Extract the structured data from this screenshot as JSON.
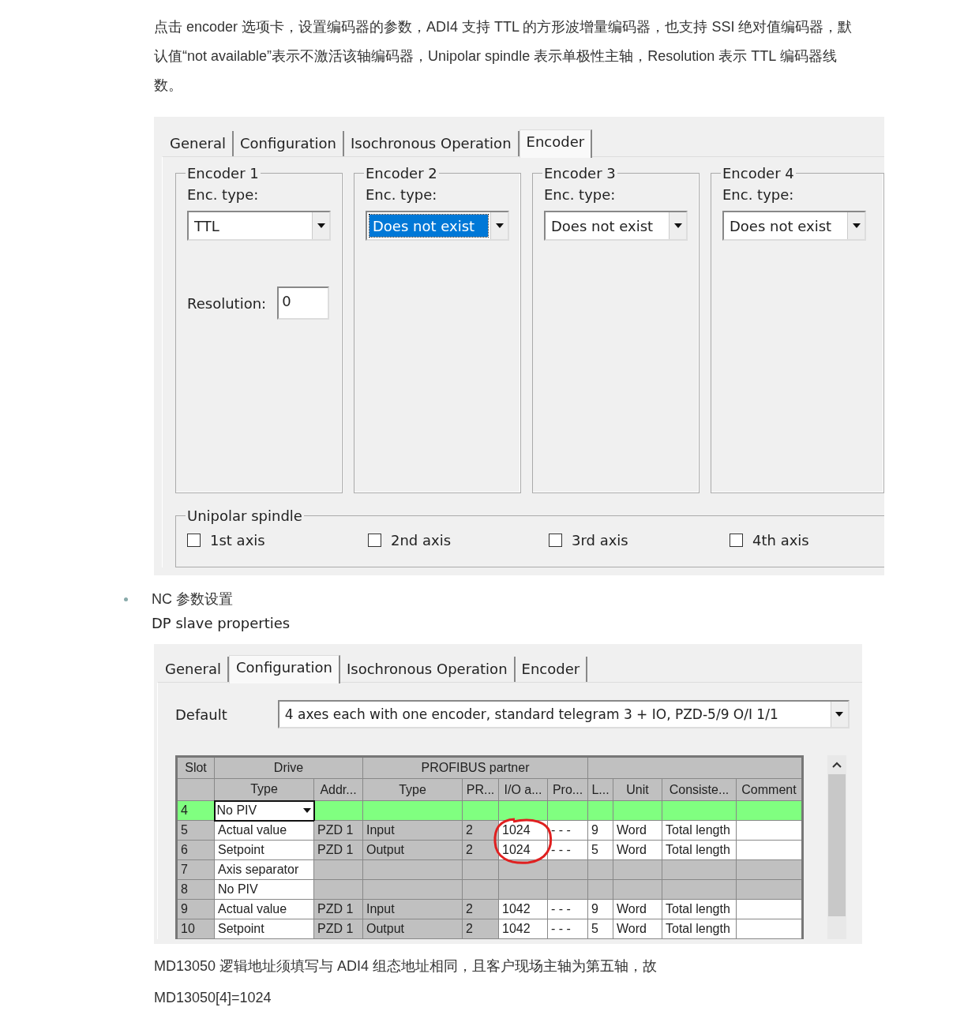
{
  "intro": "点击 encoder 选项卡，设置编码器的参数，ADI4 支持 TTL 的方形波增量编码器，也支持 SSI 绝对值编码器，默认值“not available”表示不激活该轴编码器，Unipolar spindle 表示单极性主轴，Resolution 表示 TTL 编码器线数。",
  "encoder_dialog": {
    "tabs": [
      {
        "label": "General",
        "selected": false
      },
      {
        "label": "Configuration",
        "selected": false
      },
      {
        "label": "Isochronous Operation",
        "selected": false
      },
      {
        "label": "Encoder",
        "selected": true
      }
    ],
    "encoders": [
      {
        "title": "Encoder 1",
        "type_label": "Enc. type:",
        "value": "TTL",
        "focused": false,
        "resolution_label": "Resolution:",
        "resolution": "0"
      },
      {
        "title": "Encoder 2",
        "type_label": "Enc. type:",
        "value": "Does not exist",
        "focused": true
      },
      {
        "title": "Encoder 3",
        "type_label": "Enc. type:",
        "value": "Does not exist",
        "focused": false
      },
      {
        "title": "Encoder 4",
        "type_label": "Enc. type:",
        "value": "Does not exist",
        "focused": false
      }
    ],
    "spindle": {
      "title": "Unipolar spindle",
      "axes": [
        {
          "label": "1st axis",
          "checked": false
        },
        {
          "label": "2nd axis",
          "checked": false
        },
        {
          "label": "3rd axis",
          "checked": false
        },
        {
          "label": "4th axis",
          "checked": false
        }
      ]
    }
  },
  "bullet": "NC 参数设置",
  "caption": "DP slave properties",
  "config_dialog": {
    "tabs": [
      {
        "label": "General",
        "selected": false
      },
      {
        "label": "Configuration",
        "selected": true
      },
      {
        "label": "Isochronous Operation",
        "selected": false
      },
      {
        "label": "Encoder",
        "selected": false
      }
    ],
    "default_label": "Default",
    "default_value": "4 axes each with one encoder, standard telegram 3 + IO, PZD-5/9 O/I 1/1",
    "table": {
      "group_headers": [
        "Slot",
        "Drive",
        "PROFIBUS partner"
      ],
      "columns": [
        "",
        "Type",
        "Addr...",
        "Type",
        "PR...",
        "I/O a...",
        "Pro...",
        "L...",
        "Unit",
        "Consiste...",
        "Comment"
      ],
      "rows": [
        {
          "kind": "marker",
          "selected": true,
          "cells": [
            "4",
            "No PIV",
            "",
            "",
            "",
            "",
            "",
            "",
            "",
            "",
            ""
          ]
        },
        {
          "kind": "data",
          "selected": false,
          "cells": [
            "5",
            "Actual value",
            "PZD 1",
            "Input",
            "2",
            "1024",
            "- - -",
            "9",
            "Word",
            "Total length",
            ""
          ]
        },
        {
          "kind": "data",
          "selected": false,
          "cells": [
            "6",
            "Setpoint",
            "PZD 1",
            "Output",
            "2",
            "1024",
            "- - -",
            "5",
            "Word",
            "Total length",
            ""
          ]
        },
        {
          "kind": "marker",
          "selected": false,
          "cells": [
            "7",
            "Axis separator",
            "",
            "",
            "",
            "",
            "",
            "",
            "",
            "",
            ""
          ]
        },
        {
          "kind": "marker",
          "selected": false,
          "cells": [
            "8",
            "No PIV",
            "",
            "",
            "",
            "",
            "",
            "",
            "",
            "",
            ""
          ]
        },
        {
          "kind": "data",
          "selected": false,
          "cells": [
            "9",
            "Actual value",
            "PZD 1",
            "Input",
            "2",
            "1042",
            "- - -",
            "9",
            "Word",
            "Total length",
            ""
          ]
        },
        {
          "kind": "data",
          "selected": false,
          "cells": [
            "10",
            "Setpoint",
            "PZD 1",
            "Output",
            "2",
            "1042",
            "- - -",
            "5",
            "Word",
            "Total length",
            ""
          ]
        }
      ]
    }
  },
  "notes": [
    "MD13050 逻辑地址须填写与 ADI4 组态地址相同，且客户现场主轴为第五轴，故",
    "MD13050[4]=1024"
  ]
}
